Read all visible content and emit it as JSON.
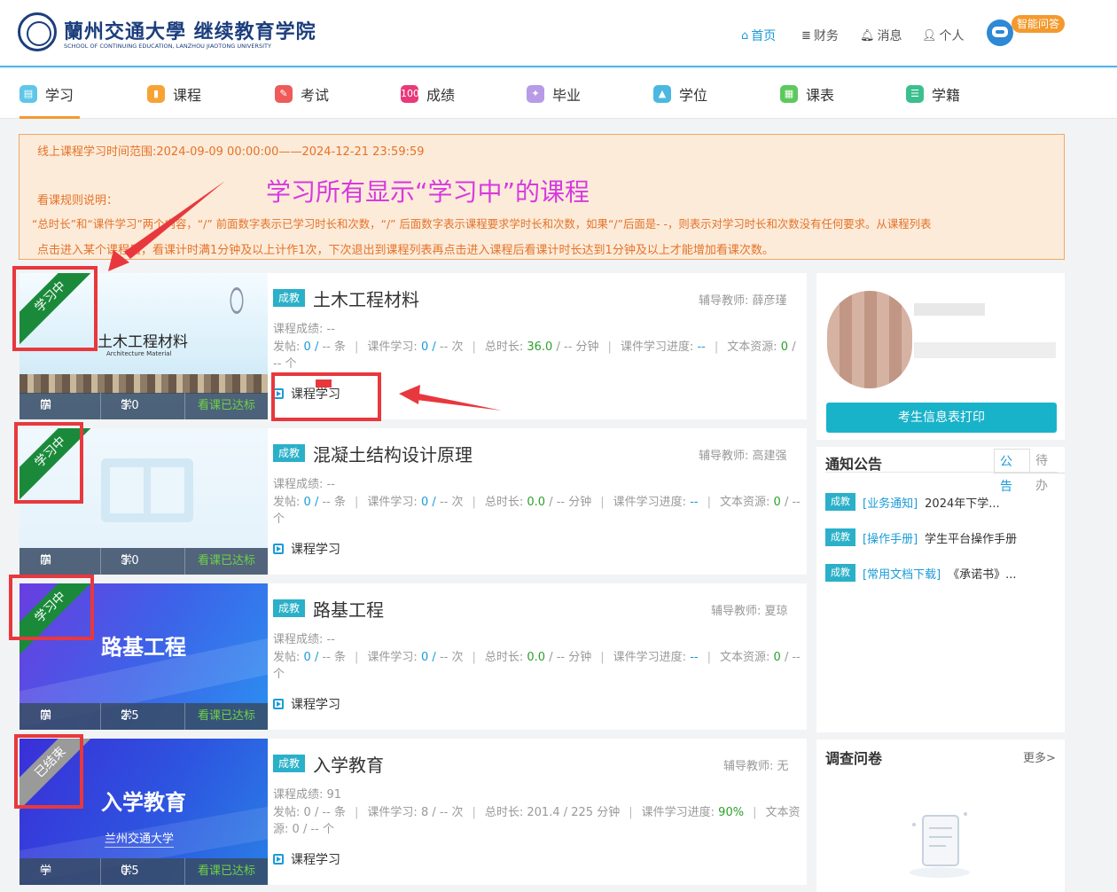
{
  "header": {
    "logo_cn": "蘭州交通大學 继续教育学院",
    "logo_en": "SCHOOL OF CONTINUING EDUCATION, LANZHOU JIAOTONG UNIVERSITY",
    "nav": {
      "home": "首页",
      "finance": "财务",
      "messages": "消息",
      "personal": "个人"
    },
    "ai_badge": "智能问答"
  },
  "tabs": [
    "学习",
    "课程",
    "考试",
    "成绩",
    "毕业",
    "学位",
    "课表",
    "学籍"
  ],
  "notice": {
    "time_range": "线上课程学习时间范围:2024-09-09 00:00:00——2024-12-21 23:59:59",
    "rules_title": "看课规则说明：",
    "rule_line1": "“总时长”和“课件学习”两个内容，“/” 前面数字表示已学习时长和次数，“/” 后面数字表示课程要求学时长和次数，如果“/”后面是- -，则表示对学习时长和次数没有任何要求。从课程列表",
    "rule_line2": "点击进入某个课程后，看课计时满1分钟及以上计作1次，下次退出到课程列表再点击进入课程后看课计时长达到1分钟及以上才能增加看课次数。"
  },
  "annotation": "学习所有显示“学习中”的课程",
  "labels": {
    "term": "学期:",
    "credit": "学分:",
    "score": "课程成绩:",
    "posts": "发帖:",
    "courseware": "课件学习:",
    "total": "总时长:",
    "progress": "课件学习进度:",
    "text_res": "文本资源:",
    "teacher": "辅导教师:",
    "study": "课程学习",
    "slash": "/",
    "unit_tiao": "条",
    "unit_ci": "次",
    "unit_min": "分钟",
    "unit_ge": "个"
  },
  "courses": [
    {
      "status": "学习中",
      "tag": "成教",
      "name": "土木工程材料",
      "teacher": "薛彦瑾",
      "thumb_title": "土木工程材料",
      "thumb_sub": "Architecture Material",
      "term": "四",
      "credit": "3.0",
      "view_status": "看课已达标",
      "score": "--",
      "posts_done": "0",
      "posts_req": "--",
      "cw_done": "0",
      "cw_req": "--",
      "total_done": "36.0",
      "total_req": "--",
      "progress": "--",
      "text_done": "0",
      "text_req": "--"
    },
    {
      "status": "学习中",
      "tag": "成教",
      "name": "混凝土结构设计原理",
      "teacher": "高建强",
      "thumb_title": "",
      "thumb_sub": "",
      "term": "四",
      "credit": "3.0",
      "view_status": "看课已达标",
      "score": "--",
      "posts_done": "0",
      "posts_req": "--",
      "cw_done": "0",
      "cw_req": "--",
      "total_done": "0.0",
      "total_req": "--",
      "progress": "--",
      "text_done": "0",
      "text_req": "--"
    },
    {
      "status": "学习中",
      "tag": "成教",
      "name": "路基工程",
      "teacher": "夏琼",
      "thumb_title": "路基工程",
      "thumb_sub": "",
      "term": "四",
      "credit": "2.5",
      "view_status": "看课已达标",
      "score": "--",
      "posts_done": "0",
      "posts_req": "--",
      "cw_done": "0",
      "cw_req": "--",
      "total_done": "0.0",
      "total_req": "--",
      "progress": "--",
      "text_done": "0",
      "text_req": "--"
    },
    {
      "status": "已结束",
      "tag": "成教",
      "name": "入学教育",
      "teacher": "无",
      "thumb_title": "入学教育",
      "thumb_sub": "兰州交通大学",
      "term": "一",
      "credit": "0.5",
      "view_status": "看课已达标",
      "score": "91",
      "posts_done": "0",
      "posts_req": "--",
      "cw_done": "8",
      "cw_req": "--",
      "total_done": "201.4",
      "total_req": "225",
      "progress": "90%",
      "text_done": "0",
      "text_req": "--"
    }
  ],
  "profile": {
    "print_button": "考生信息表打印"
  },
  "notices": {
    "title": "通知公告",
    "tab_announce": "公告",
    "tab_todo": "待办",
    "items": [
      {
        "tag": "成教",
        "category": "[业务通知]",
        "text": "2024年下学..."
      },
      {
        "tag": "成教",
        "category": "[操作手册]",
        "text": "学生平台操作手册"
      },
      {
        "tag": "成教",
        "category": "[常用文档下载]",
        "text": "《承诺书》..."
      }
    ]
  },
  "survey": {
    "title": "调查问卷",
    "more": "更多>"
  },
  "colors": {
    "accent": "#1a9bd8",
    "tab_underline": "#f39a2e",
    "tag": "#2ab0c8",
    "annotation_red": "#e8383d",
    "annotation_pink": "#d63ae0"
  }
}
